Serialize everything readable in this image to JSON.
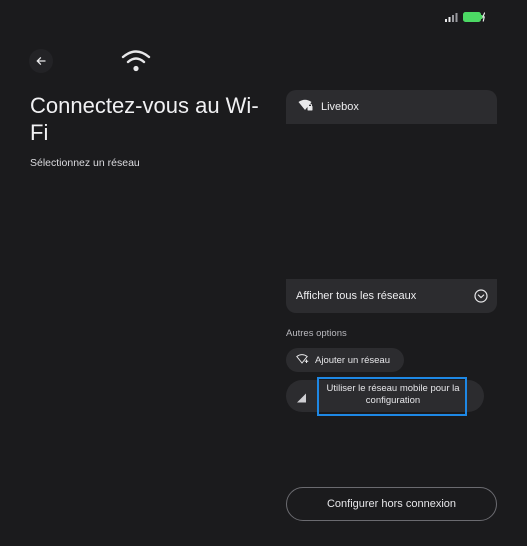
{
  "status_bar": {
    "signal_icon": "cell-signal-icon",
    "battery_icon": "battery-charging-icon",
    "battery_color": "#4cd964"
  },
  "header": {
    "back_icon": "arrow-left-icon",
    "wifi_icon": "wifi-icon"
  },
  "page": {
    "title": "Connectez-vous au Wi-Fi",
    "subtitle": "Sélectionnez un réseau"
  },
  "networks": [
    {
      "name": "Livebox",
      "icon": "wifi-locked-icon"
    }
  ],
  "show_all": {
    "label": "Afficher tous les réseaux",
    "icon": "chevron-down-circle-icon"
  },
  "other_options": {
    "label": "Autres options",
    "add_network": {
      "label": "Ajouter un réseau",
      "icon": "wifi-add-icon"
    },
    "mobile_network": {
      "label": "Utiliser le réseau mobile pour la configuration",
      "icon": "cell-signal-icon"
    }
  },
  "footer": {
    "offline_label": "Configurer hors connexion"
  },
  "colors": {
    "background": "#1b1b1d",
    "card": "#2c2c2f",
    "highlight": "#1e88e5"
  }
}
